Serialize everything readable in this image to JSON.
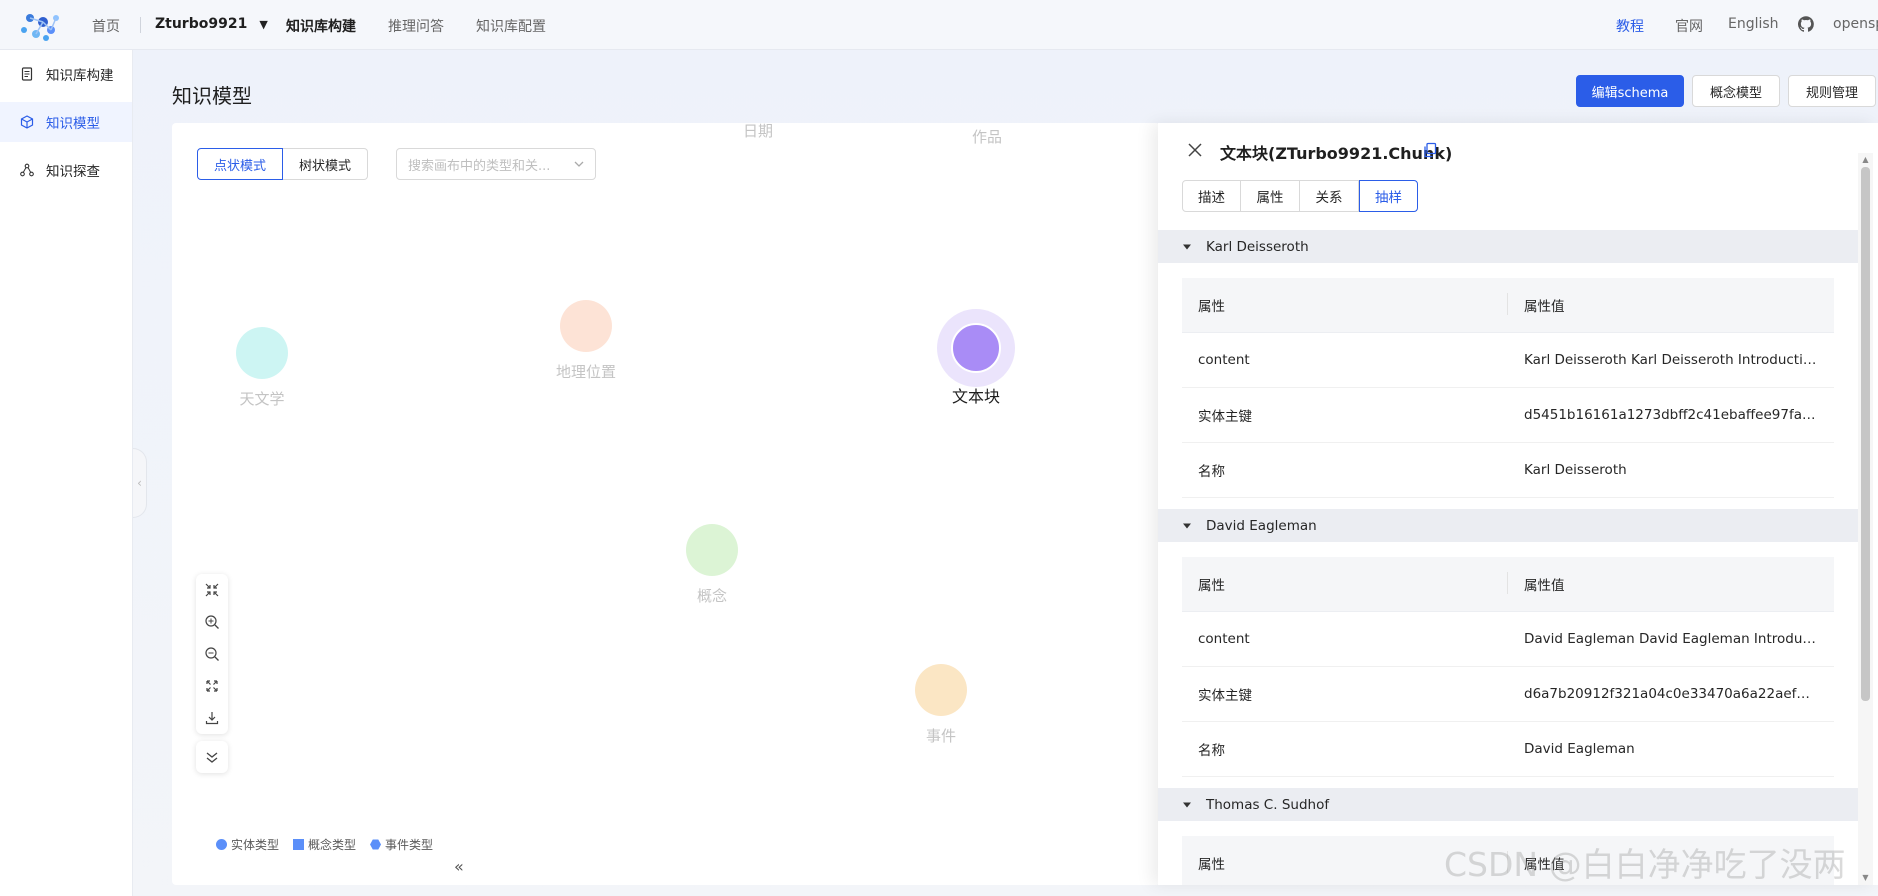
{
  "topbar": {
    "nav": [
      "首页",
      "Zturbo9921",
      "知识库构建",
      "推理问答",
      "知识库配置"
    ],
    "right": [
      "教程",
      "官网",
      "English",
      "opensp"
    ]
  },
  "sidebar": {
    "items": [
      {
        "label": "知识库构建",
        "icon": "document-icon"
      },
      {
        "label": "知识模型",
        "icon": "cube-icon"
      },
      {
        "label": "知识探查",
        "icon": "graph-nodes-icon"
      }
    ]
  },
  "page": {
    "title": "知识模型",
    "buttons": [
      "编辑schema",
      "概念模型",
      "规则管理"
    ]
  },
  "canvas": {
    "modes": [
      "点状模式",
      "树状模式"
    ],
    "search_placeholder": "搜索画布中的类型和关...",
    "nodes": {
      "date": "日期",
      "work": "作品",
      "astronomy": "天文学",
      "location": "地理位置",
      "chunk": "文本块",
      "concept": "概念",
      "event": "事件"
    },
    "legend": [
      "实体类型",
      "概念类型",
      "事件类型"
    ],
    "collapse": "«"
  },
  "drawer": {
    "title": "文本块(ZTurbo9921.Chunk)",
    "tabs": [
      "描述",
      "属性",
      "关系",
      "抽样"
    ],
    "table_head": [
      "属性",
      "属性值"
    ],
    "groups": [
      {
        "name": "Karl Deisseroth",
        "rows": [
          {
            "k": "content",
            "v": "Karl Deisseroth Karl Deisseroth Introduction K..."
          },
          {
            "k": "实体主键",
            "v": "d5451b16161a1273dbff2c41ebaffee97faac32..."
          },
          {
            "k": "名称",
            "v": "Karl Deisseroth"
          }
        ]
      },
      {
        "name": "David Eagleman",
        "rows": [
          {
            "k": "content",
            "v": "David Eagleman David Eagleman Introduction..."
          },
          {
            "k": "实体主键",
            "v": "d6a7b20912f321a04c0e33470a6a22aef82583..."
          },
          {
            "k": "名称",
            "v": "David Eagleman"
          }
        ]
      },
      {
        "name": "Thomas C. Sudhof",
        "rows": []
      }
    ]
  },
  "watermark": "CSDN @白白净净吃了没两"
}
